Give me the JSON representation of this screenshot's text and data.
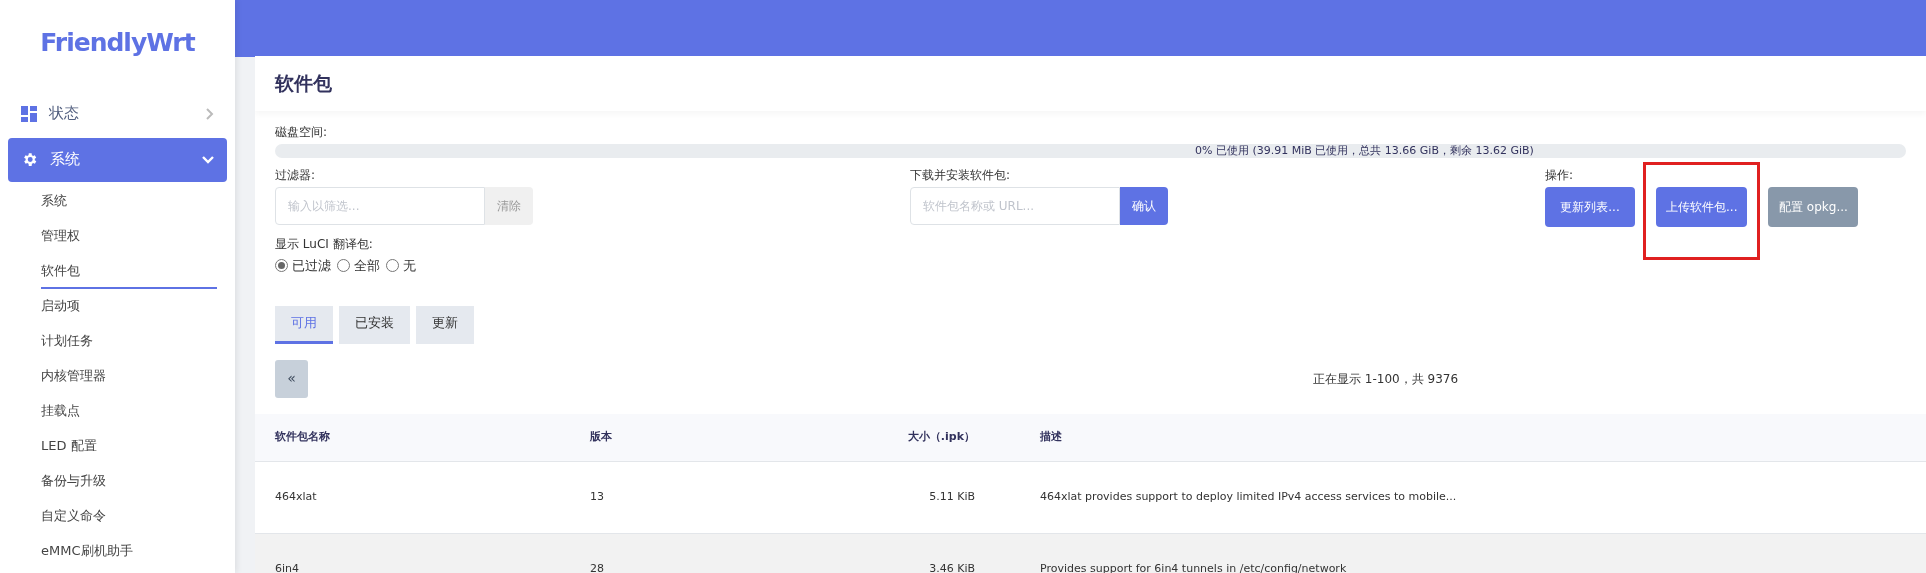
{
  "logo": "FriendlyWrt",
  "sidebar": {
    "items": [
      {
        "label": "状态",
        "kind": "dashboard",
        "expanded": false,
        "selected": false
      },
      {
        "label": "系统",
        "kind": "settings",
        "expanded": true,
        "selected": true,
        "children": [
          {
            "label": "系统",
            "selected": false
          },
          {
            "label": "管理权",
            "selected": false
          },
          {
            "label": "软件包",
            "selected": true
          },
          {
            "label": "启动项",
            "selected": false
          },
          {
            "label": "计划任务",
            "selected": false
          },
          {
            "label": "内核管理器",
            "selected": false
          },
          {
            "label": "挂载点",
            "selected": false
          },
          {
            "label": "LED 配置",
            "selected": false
          },
          {
            "label": "备份与升级",
            "selected": false
          },
          {
            "label": "自定义命令",
            "selected": false
          },
          {
            "label": "eMMC刷机助手",
            "selected": false
          }
        ]
      }
    ]
  },
  "page_title": "软件包",
  "disk": {
    "label": "磁盘空间:",
    "reading": "0% 已使用 (39.91 MiB 已使用，总共 13.66 GiB，剩余 13.62 GiB)"
  },
  "filter": {
    "label": "过滤器:",
    "placeholder": "输入以筛选...",
    "button": "清除"
  },
  "download": {
    "label": "下载并安装软件包:",
    "placeholder": "软件包名称或 URL...",
    "button": "确认"
  },
  "actions": {
    "label": "操作:",
    "buttons": [
      {
        "label": "更新列表...",
        "kind": "primary",
        "highlighted": false
      },
      {
        "label": "上传软件包...",
        "kind": "primary",
        "highlighted": true
      },
      {
        "label": "配置 opkg...",
        "kind": "secondary",
        "highlighted": false
      }
    ]
  },
  "translations": {
    "label": "显示 LuCI 翻译包:",
    "options": [
      {
        "label": "已过滤",
        "selected": true
      },
      {
        "label": "全部",
        "selected": false
      },
      {
        "label": "无",
        "selected": false
      }
    ]
  },
  "tabs": [
    {
      "label": "可用",
      "selected": true
    },
    {
      "label": "已安装",
      "selected": false
    },
    {
      "label": "更新",
      "selected": false
    }
  ],
  "pager": {
    "prev": "«",
    "status": "正在显示 1-100，共 9376"
  },
  "table": {
    "columns": [
      "软件包名称",
      "版本",
      "大小（.ipk）",
      "描述"
    ],
    "rows": [
      [
        "464xlat",
        "13",
        "5.11 KiB",
        "464xlat provides support to deploy limited IPv4 access services to mobile..."
      ],
      [
        "6in4",
        "28",
        "3.46 KiB",
        "Provides support for 6in4 tunnels in /etc/config/network"
      ]
    ]
  }
}
